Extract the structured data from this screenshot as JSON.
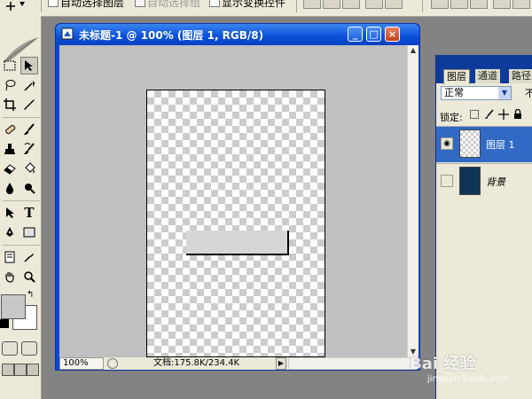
{
  "options_bar": {
    "auto_select_layer": "自动选择图层",
    "auto_select_group": "自动选择组",
    "show_transform_controls": "显示变换控件"
  },
  "document": {
    "title": "未标题-1 @ 100% (图层 1, RGB/8)",
    "zoom": "100%",
    "doc_info": "文档:175.8K/234.4K"
  },
  "window_buttons": {
    "minimize": "_",
    "maximize": "□",
    "close": "×"
  },
  "layers_panel": {
    "tabs": [
      "图层",
      "通道",
      "路径"
    ],
    "blend_mode": "正常",
    "opacity_label": "不",
    "lock_label": "锁定:",
    "layers": [
      {
        "name": "图层 1",
        "visible": true,
        "selected": true
      },
      {
        "name": "背景",
        "visible": false,
        "selected": false
      }
    ]
  },
  "watermark": {
    "brand": "Bai 经验",
    "url": "jingyan.baidu.com"
  },
  "colors": {
    "titlebar": "#0a4fd8",
    "canvas_bg": "#c0c0c0",
    "layer_selected": "#316ac5",
    "background_layer": "#0f3556",
    "shape_fill": "#d6d6d6"
  }
}
